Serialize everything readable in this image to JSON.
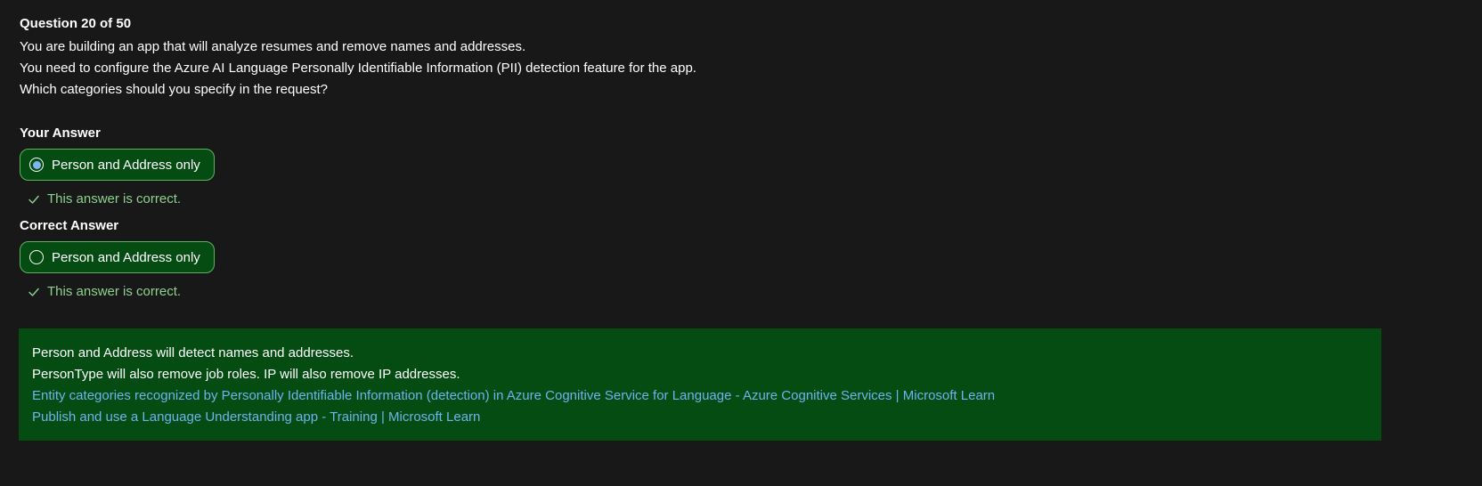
{
  "question": {
    "counter": "Question 20 of 50",
    "lines": [
      "You are building an app that will analyze resumes and remove names and addresses.",
      "You need to configure the Azure AI Language Personally Identifiable Information (PII) detection feature for the app.",
      "Which categories should you specify in the request?"
    ]
  },
  "your_answer": {
    "title": "Your Answer",
    "option_label": "Person and Address only",
    "selected": true,
    "feedback": "This answer is correct."
  },
  "correct_answer": {
    "title": "Correct Answer",
    "option_label": "Person and Address only",
    "selected": false,
    "feedback": "This answer is correct."
  },
  "explanation": {
    "lines": [
      "Person and Address will detect names and addresses.",
      "PersonType will also remove job roles. IP will also remove IP addresses."
    ],
    "links": [
      "Entity categories recognized by Personally Identifiable Information (detection) in Azure Cognitive Service for Language - Azure Cognitive Services | Microsoft Learn",
      "Publish and use a Language Understanding app - Training | Microsoft Learn"
    ]
  },
  "colors": {
    "background": "#181818",
    "pill_background": "#054c13",
    "pill_border": "#5fb25f",
    "feedback_text": "#8fd18f",
    "link": "#6cb3f0",
    "radio_dot": "#7fb4ef"
  },
  "icons": {
    "feedback": "check-icon",
    "selected_radio": "radio-selected-icon",
    "unselected_radio": "radio-unselected-icon"
  }
}
